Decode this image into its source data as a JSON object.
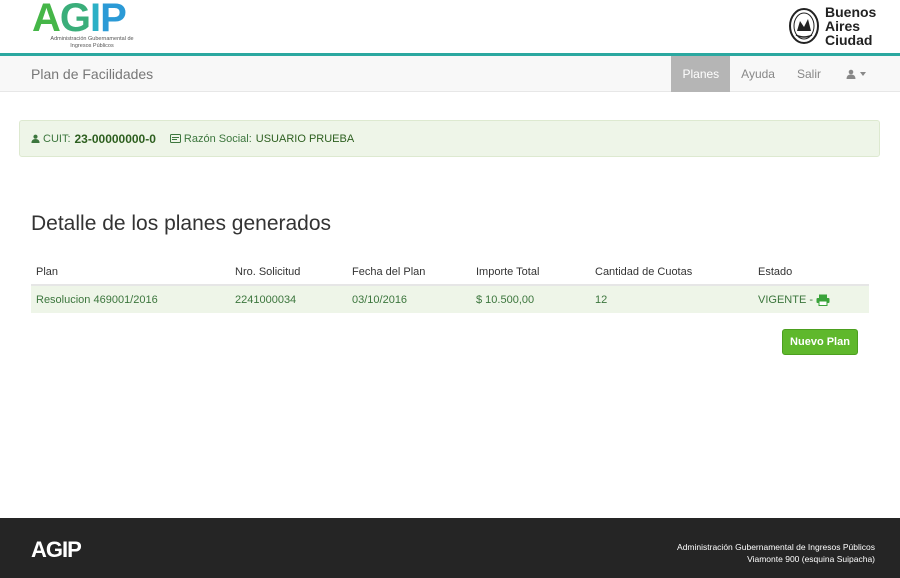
{
  "header": {
    "agip_logo": {
      "word": "AGIP",
      "sub": "Administración Gubernamental de Ingresos Públicos"
    },
    "ba_logo": {
      "line1": "Buenos",
      "line2": "Aires",
      "line3": "Ciudad"
    }
  },
  "navbar": {
    "brand": "Plan de Facilidades",
    "items": [
      {
        "label": "Planes",
        "active": true
      },
      {
        "label": "Ayuda",
        "active": false
      },
      {
        "label": "Salir",
        "active": false
      }
    ]
  },
  "info": {
    "cuit_label": "CUIT:",
    "cuit_value": "23-00000000-0",
    "razon_label": "Razón Social:",
    "razon_value": "USUARIO PRUEBA"
  },
  "main": {
    "title": "Detalle de los planes generados",
    "table": {
      "headers": [
        "Plan",
        "Nro. Solicitud",
        "Fecha del Plan",
        "Importe Total",
        "Cantidad de Cuotas",
        "Estado"
      ],
      "rows": [
        [
          "Resolucion 469001/2016",
          "2241000034",
          "03/10/2016",
          "$ 10.500,00",
          "12",
          "VIGENTE -"
        ]
      ]
    },
    "new_plan_button": "Nuevo Plan"
  },
  "footer": {
    "logo": "AGIP",
    "line1": "Administración Gubernamental de Ingresos Públicos",
    "line2": "Viamonte 900 (esquina Suipacha)"
  },
  "colors": {
    "accent_green": "#5fb82c",
    "teal_line": "#2ba8a0",
    "alert_bg": "#eef5e8"
  }
}
